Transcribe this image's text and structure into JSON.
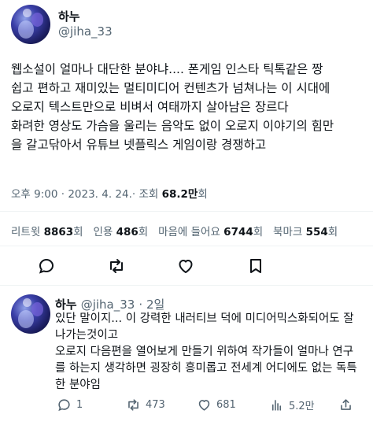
{
  "tweet": {
    "author_name": "하누",
    "author_handle": "@jiha_33",
    "lines": [
      "웹소설이 얼마나 대단한 분야냐.... 폰게임 인스타 틱톡같은 짱",
      "쉽고 편하고 재미있는 멀티미디어 컨텐츠가 넘쳐나는 이 시대에",
      "오로지 텍스트만으로 비벼서 여태까지 살아남은 장르다",
      "화려한 영상도 가슴을 울리는 음악도 없이 오로지 이야기의 힘만",
      "을 갈고닦아서 유튜브 넷플릭스 게임이랑 경쟁하고"
    ],
    "timestamp": "오후 9:00 · 2023. 4. 24.",
    "views_label": "· 조회 ",
    "views_value": "68.2만",
    "views_suffix": "회",
    "stats": {
      "retweets_label": "리트윗",
      "retweets_value": "8863",
      "quotes_label": "인용",
      "quotes_value": "486",
      "likes_label": "마음에 들어요",
      "likes_value": "6744",
      "bookmarks_label": "북마크",
      "bookmarks_value": "554",
      "unit": "회"
    },
    "action_icons": [
      "reply-icon",
      "retweet-icon",
      "like-icon",
      "bookmark-icon"
    ]
  },
  "reply": {
    "author_name": "하누",
    "author_handle": "@jiha_33",
    "time": "· 2일",
    "lines": [
      "있단 말이지... 이 강력한 내러티브 덕에 미디어믹스화되어도 잘",
      "나가는것이고",
      "오로지 다음편을 열어보게 만들기 위하여 작가들이 얼마나 연구",
      "를 하는지 생각하면 굉장히 흥미롭고 전세계 어디에도 없는 독특",
      "한 분야임"
    ],
    "counts": {
      "replies": "1",
      "retweets": "473",
      "likes": "681",
      "views": "5.2만"
    }
  },
  "colors": {
    "text": "#0f1419",
    "secondary": "#536471",
    "divider": "#eff3f4"
  }
}
